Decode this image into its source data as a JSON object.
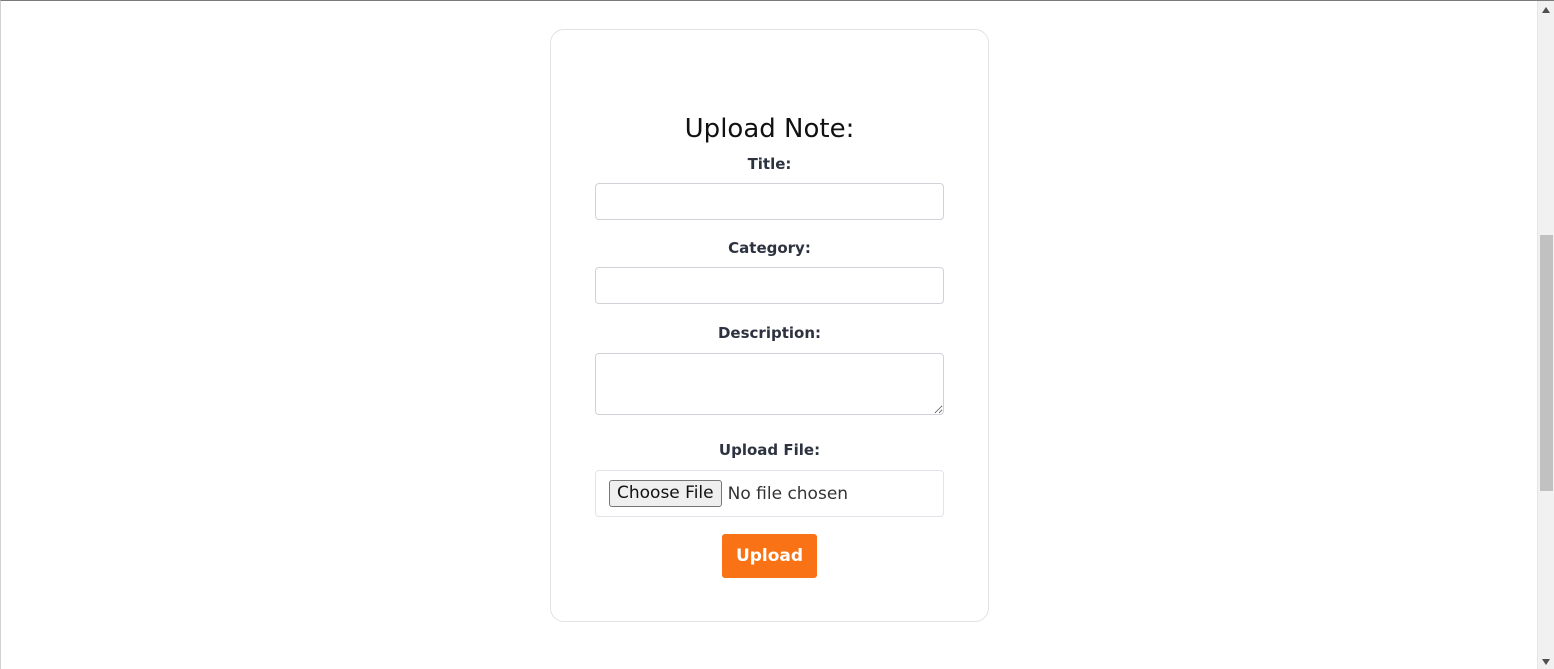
{
  "form": {
    "heading": "Upload Note:",
    "title_label": "Title:",
    "title_value": "",
    "category_label": "Category:",
    "category_value": "",
    "description_label": "Description:",
    "description_value": "",
    "file_label": "Upload File:",
    "choose_file_label": "Choose File",
    "file_status": "No file chosen",
    "submit_label": "Upload"
  },
  "colors": {
    "accent": "#f97316"
  },
  "icons": {
    "scroll_up": "caret-up-icon",
    "scroll_down": "caret-down-icon"
  }
}
